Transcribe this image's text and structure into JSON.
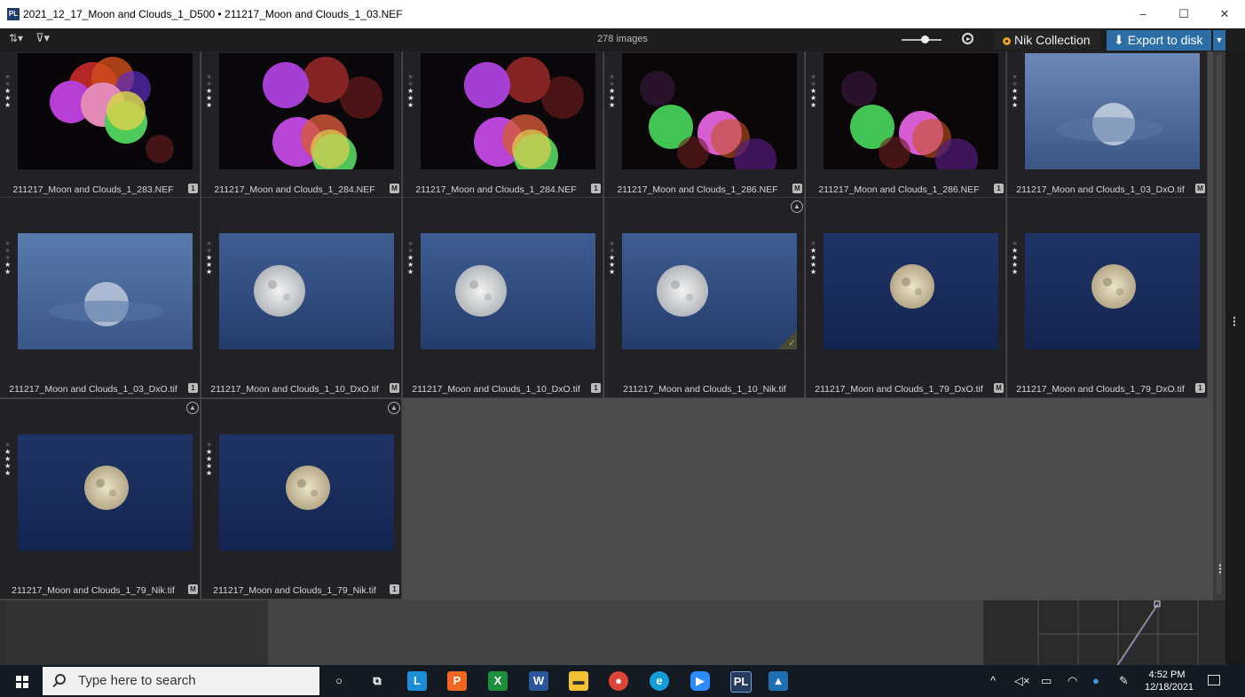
{
  "window": {
    "title": "2021_12_17_Moon and Clouds_1_D500 • 211217_Moon and Clouds_1_03.NEF",
    "minimize": "–",
    "maximize": "☐",
    "close": "✕"
  },
  "toolbar": {
    "sort_icon": "sort-az-icon",
    "filter_icon": "filter-icon",
    "image_count": "278 images",
    "nik_label": "Nik Collection",
    "export_label": "Export to disk"
  },
  "thumbnails": [
    {
      "name": "211217_Moon and Clouds_1_283.NEF",
      "badge": "1",
      "stars": 3,
      "kind": "bokeh1"
    },
    {
      "name": "211217_Moon and Clouds_1_284.NEF",
      "badge": "M",
      "stars": 3,
      "kind": "bokeh2"
    },
    {
      "name": "211217_Moon and Clouds_1_284.NEF",
      "badge": "1",
      "stars": 3,
      "kind": "bokeh2"
    },
    {
      "name": "211217_Moon and Clouds_1_286.NEF",
      "badge": "M",
      "stars": 3,
      "kind": "bokeh3"
    },
    {
      "name": "211217_Moon and Clouds_1_286.NEF",
      "badge": "1",
      "stars": 3,
      "kind": "bokeh3"
    },
    {
      "name": "211217_Moon and Clouds_1_03_DxO.tif",
      "badge": "M",
      "stars": 3,
      "kind": "moonhazy"
    },
    {
      "name": "211217_Moon and Clouds_1_03_DxO.tif",
      "badge": "1",
      "stars": 2,
      "kind": "moonhazy2"
    },
    {
      "name": "211217_Moon and Clouds_1_10_DxO.tif",
      "badge": "M",
      "stars": 3,
      "kind": "moonbright"
    },
    {
      "name": "211217_Moon and Clouds_1_10_DxO.tif",
      "badge": "1",
      "stars": 3,
      "kind": "moonbright"
    },
    {
      "name": "211217_Moon and Clouds_1_10_Nik.tif",
      "badge": "",
      "stars": 3,
      "kind": "moonbright",
      "tagged": true,
      "checked": true
    },
    {
      "name": "211217_Moon and Clouds_1_79_DxO.tif",
      "badge": "M",
      "stars": 4,
      "kind": "moondark"
    },
    {
      "name": "211217_Moon and Clouds_1_79_DxO.tif",
      "badge": "1",
      "stars": 4,
      "kind": "moondark"
    },
    {
      "name": "211217_Moon and Clouds_1_79_Nik.tif",
      "badge": "M",
      "stars": 4,
      "kind": "moondark",
      "tagged": true
    },
    {
      "name": "211217_Moon and Clouds_1_79_Nik.tif",
      "badge": "1",
      "stars": 4,
      "kind": "moondark",
      "tagged": true
    }
  ],
  "taskbar": {
    "search_placeholder": "Type here to search",
    "time": "4:52 PM",
    "date": "12/18/2021"
  }
}
